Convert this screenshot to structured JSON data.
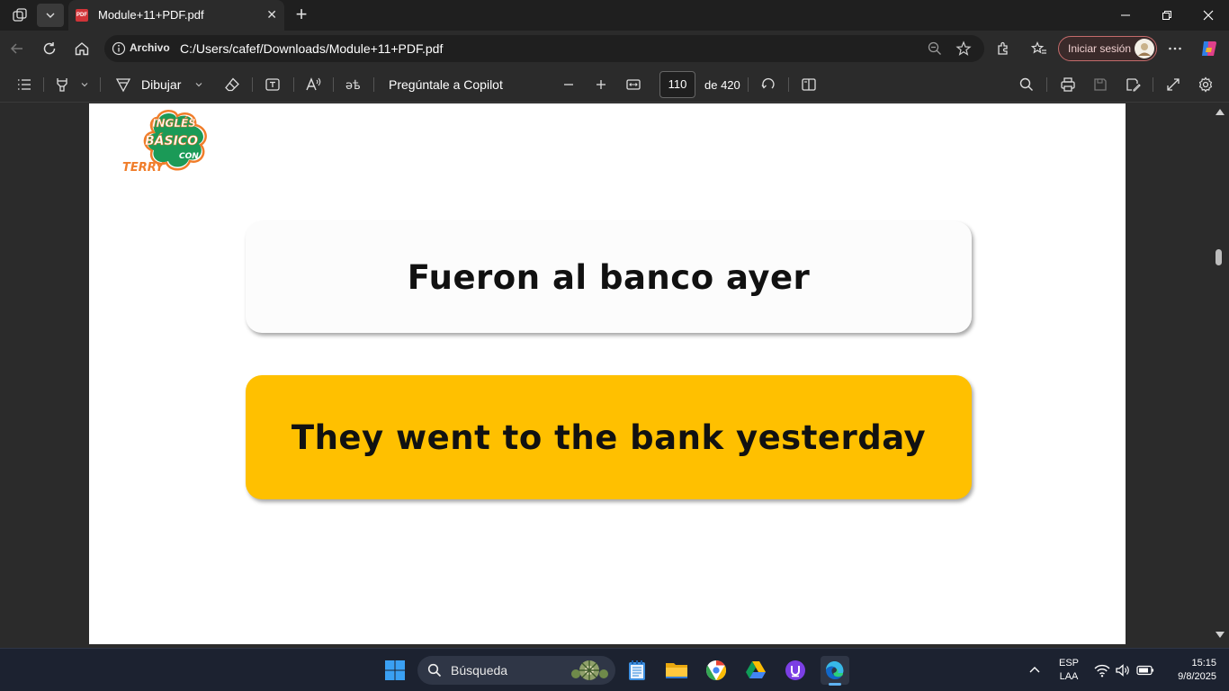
{
  "tab": {
    "title": "Module+11+PDF.pdf",
    "badge": "PDF"
  },
  "address": {
    "site_label": "Archivo",
    "url": "C:/Users/cafef/Downloads/Module+11+PDF.pdf",
    "signin_label": "Iniciar sesión"
  },
  "pdf_toolbar": {
    "draw_label": "Dibujar",
    "copilot_label": "Pregúntale a Copilot",
    "page_current": "110",
    "page_total": "de 420"
  },
  "document": {
    "logo_text": [
      "INGLÉS",
      "BÁSICO",
      "CON",
      "TERRY"
    ],
    "spanish_sentence": "Fueron al banco ayer",
    "english_sentence": "They went to the bank yesterday",
    "accent_color": "#ffc000"
  },
  "taskbar": {
    "search_label": "Búsqueda",
    "language": "ESP",
    "layout": "LAA",
    "time": "15:15",
    "date": "9/8/2025"
  },
  "colors": {
    "titlebar": "#1f1f1f",
    "toolbar": "#2b2b2b",
    "taskbar": "#1c2230"
  }
}
